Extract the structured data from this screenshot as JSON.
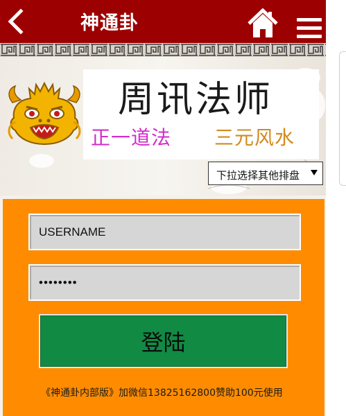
{
  "header": {
    "title": "神通卦",
    "back_icon": "chevron-left-icon",
    "home_icon": "home-icon",
    "menu_icon": "hamburger-menu-icon",
    "bg_color": "#9c0000"
  },
  "banner": {
    "brand_text": "周讯法师",
    "slogan_left": "正一道法",
    "slogan_right": "三元风水",
    "logo_icon": "dragon-head-icon"
  },
  "layout_select": {
    "selected": "下拉选择其他排盘"
  },
  "login": {
    "username_value": "USERNAME",
    "password_value": "••••••••",
    "submit_label": "登陆",
    "notice": "《神通卦内部版》加微信13825162800赞助100元使用",
    "panel_color": "#ff8c00",
    "button_color": "#118a44"
  }
}
